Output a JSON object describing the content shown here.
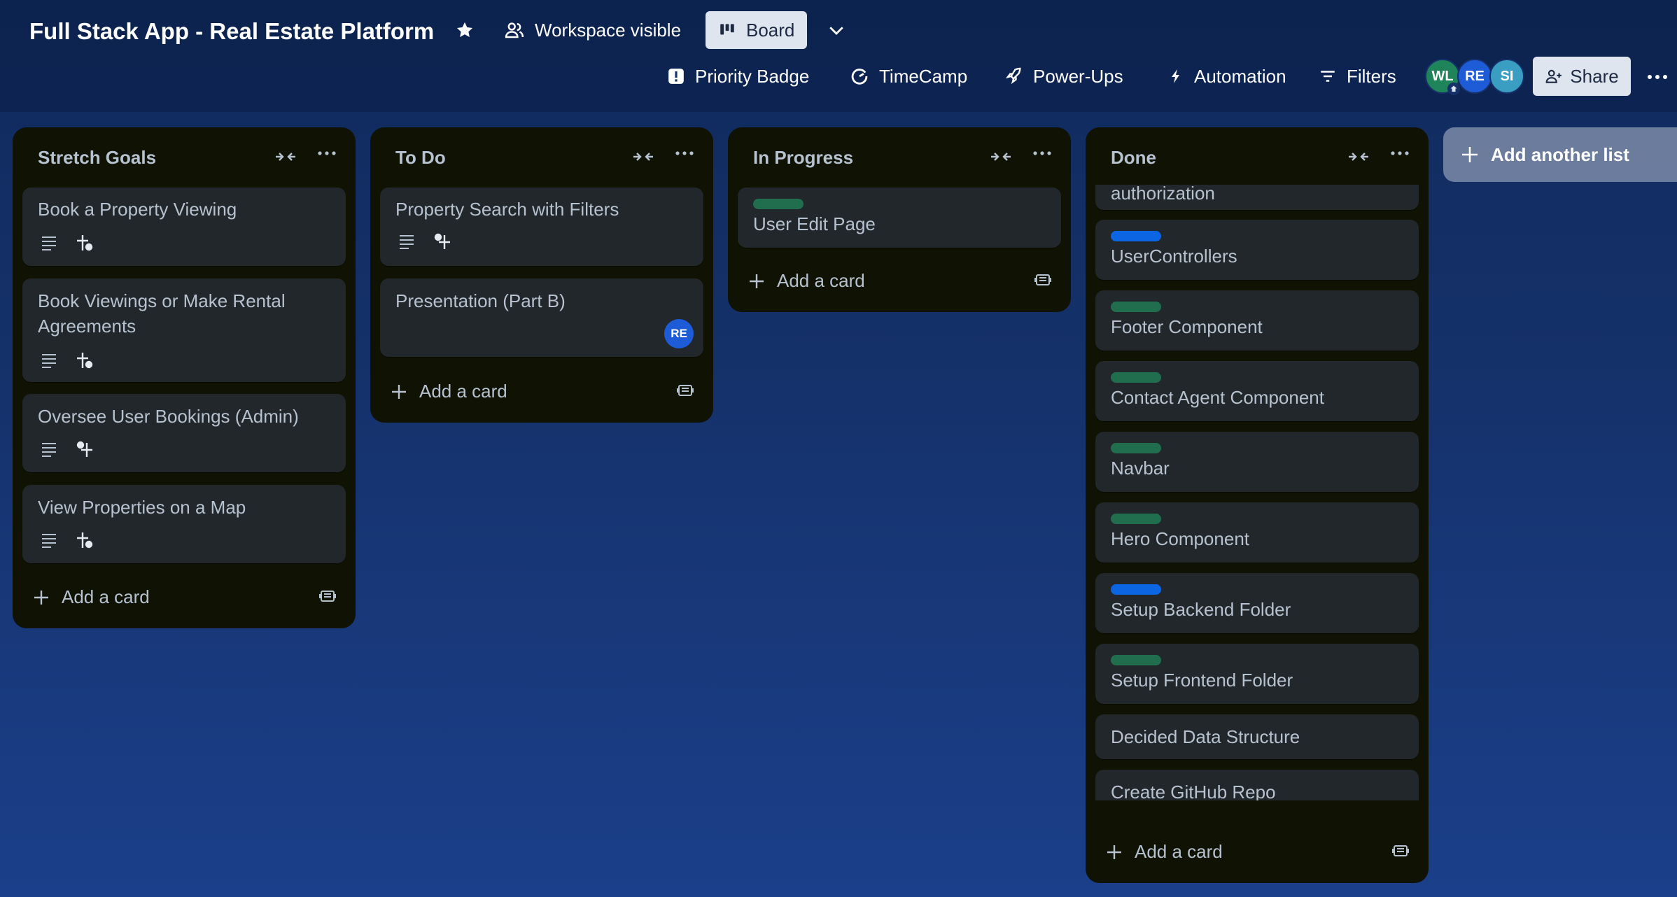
{
  "board": {
    "title": "Full Stack App - Real Estate Platform",
    "visibility": "Workspace visible",
    "view": "Board"
  },
  "toolbar": {
    "priority_badge": "Priority Badge",
    "timecamp": "TimeCamp",
    "power_ups": "Power-Ups",
    "automation": "Automation",
    "filters": "Filters",
    "share": "Share"
  },
  "members": [
    "WL",
    "RE",
    "SI"
  ],
  "colors": {
    "background": "#15316a",
    "list_bg": "#101204",
    "card_bg": "#22272b",
    "label_green": "#216e4e",
    "label_blue": "#0c66e4",
    "avatar_green": "#1f845a",
    "avatar_blue": "#1e5bd7",
    "avatar_teal": "#3a9ec2"
  },
  "lists": [
    {
      "title": "Stretch Goals",
      "cards": [
        {
          "title": "Book a Property Viewing",
          "badges": [
            "description-icon",
            "checklist-icon"
          ]
        },
        {
          "title": "Book Viewings or Make Rental Agreements",
          "badges": [
            "description-icon",
            "checklist-icon"
          ]
        },
        {
          "title": "Oversee User Bookings (Admin)",
          "badges": [
            "description-icon",
            "checklist-icon"
          ]
        },
        {
          "title": "View Properties on a Map",
          "badges": [
            "description-icon",
            "checklist-icon"
          ]
        }
      ],
      "add_card": "Add a card"
    },
    {
      "title": "To Do",
      "cards": [
        {
          "title": "Property Search with Filters",
          "badges": [
            "description-icon",
            "checklist-icon"
          ]
        },
        {
          "title": "Presentation (Part B)",
          "member": "RE"
        }
      ],
      "add_card": "Add a card"
    },
    {
      "title": "In Progress",
      "cards": [
        {
          "title": "User Edit Page",
          "label": "green"
        }
      ],
      "add_card": "Add a card"
    },
    {
      "title": "Done",
      "cards": [
        {
          "title": "authorization"
        },
        {
          "title": "UserControllers",
          "label": "blue"
        },
        {
          "title": "Footer Component",
          "label": "green"
        },
        {
          "title": "Contact Agent Component",
          "label": "green"
        },
        {
          "title": "Navbar",
          "label": "green"
        },
        {
          "title": "Hero Component",
          "label": "green"
        },
        {
          "title": "Setup Backend Folder",
          "label": "blue"
        },
        {
          "title": "Setup Frontend Folder",
          "label": "green"
        },
        {
          "title": "Decided Data Structure"
        },
        {
          "title": "Create GitHub Repo"
        }
      ],
      "add_card": "Add a card"
    }
  ],
  "add_list": "Add another list"
}
